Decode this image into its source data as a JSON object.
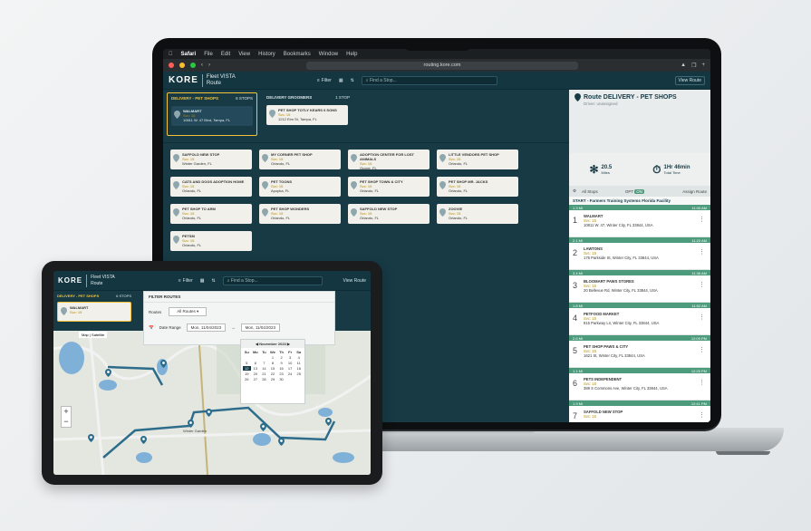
{
  "menubar": {
    "app": "Safari",
    "items": [
      "File",
      "Edit",
      "View",
      "History",
      "Bookmarks",
      "Window",
      "Help"
    ]
  },
  "browser": {
    "url": "routing.kore.com"
  },
  "app": {
    "logo": "KORE",
    "title_line1": "Fleet VISTA",
    "title_line2": "Route",
    "filter_label": "Filter",
    "search_placeholder": "Find a Stop...",
    "view_route_label": "View Route"
  },
  "groups": [
    {
      "label": "DELIVERY - PET SHOPS",
      "count": "6 STOPS",
      "stop": {
        "name": "WALMART",
        "line1": "Svc: 15",
        "line2": "10811 W. 47 Blvd, Tampa, FL"
      }
    },
    {
      "label": "DELIVERY GROOMERS",
      "count": "1 STOP",
      "stop": {
        "name": "PET SHOP TOTLY KEARS 6 SONS",
        "line1": "Svc: 15",
        "line2": "1212 Elm St, Tampa, FL"
      }
    }
  ],
  "unassigned": [
    {
      "name": "SAFFOLD NEW STOP",
      "line1": "Svc: 15",
      "line2": "Winter Garden, FL"
    },
    {
      "name": "MY CORNER PET SHOP",
      "line1": "Svc: 15",
      "line2": "Orlando, FL"
    },
    {
      "name": "ADOPTION CENTER FOR LOST ANIMALS",
      "line1": "Svc: 15",
      "line2": "Ocoee, FL"
    },
    {
      "name": "LITTLE VENDORS PET SHOP",
      "line1": "Svc: 15",
      "line2": "Orlando, FL"
    },
    {
      "name": "CATS AND DOGS ADOPTION HOME",
      "line1": "Svc: 15",
      "line2": "Orlando, FL"
    },
    {
      "name": "PET TOONS",
      "line1": "Svc: 15",
      "line2": "Apopka, FL"
    },
    {
      "name": "PET SHOP TOWN & CITY",
      "line1": "Svc: 15",
      "line2": "Orlando, FL"
    },
    {
      "name": "PET SHOP MR. JACKS",
      "line1": "Svc: 15",
      "line2": "Orlando, FL"
    },
    {
      "name": "PET SHOP TO ARM",
      "line1": "Svc: 15",
      "line2": "Orlando, FL"
    },
    {
      "name": "PET SHOP WONDERS",
      "line1": "Svc: 15",
      "line2": "Orlando, FL"
    },
    {
      "name": "SAFFOLD NEW STOP",
      "line1": "Svc: 15",
      "line2": "Orlando, FL"
    },
    {
      "name": "ZOOVIE",
      "line1": "Svc: 15",
      "line2": "Orlando, FL"
    },
    {
      "name": "PETSM",
      "line1": "Svc: 15",
      "line2": "Orlando, FL"
    }
  ],
  "route_panel": {
    "title": "Route DELIVERY - PET SHOPS",
    "subtitle": "Driver: unassigned",
    "distance": "20.5",
    "distance_unit": "Miles",
    "time": "1Hr 46min",
    "time_unit": "Total Time",
    "all_stops": "All Stops",
    "opt": "OPT",
    "assign_label": "Assign Route",
    "start": "START - Farmers Training Systems Florida Facility",
    "stops": [
      {
        "num": "1",
        "name": "WALMART",
        "svc": "Svc: 15",
        "addr": "10811 W. 47, Winter City, FL 33844, USA",
        "eta": "11:05 AM",
        "dist": "1.3 MI"
      },
      {
        "num": "2",
        "name": "LAWTONS",
        "svc": "Svc: 15",
        "addr": "176 Parkside St, Winter City, FL 33844, USA",
        "eta": "11:20 AM",
        "dist": "2.1 MI"
      },
      {
        "num": "3",
        "name": "BLOOMART PAWS STORES",
        "svc": "Svc: 15",
        "addr": "20 Bellevue Rd, Winter City, FL 33844, USA",
        "eta": "11:36 AM",
        "dist": "3.4 MI"
      },
      {
        "num": "4",
        "name": "PETFOOD MARKET",
        "svc": "Svc: 15",
        "addr": "815 Parkway Ln, Winter City, FL 33844, USA",
        "eta": "11:52 AM",
        "dist": "1.8 MI"
      },
      {
        "num": "5",
        "name": "PET SHOP PAWS & CITY",
        "svc": "Svc: 15",
        "addr": "1621 St, Winter City, FL 33844, USA",
        "eta": "12:09 PM",
        "dist": "2.6 MI"
      },
      {
        "num": "6",
        "name": "PETS INDEPENDENT",
        "svc": "Svc: 15",
        "addr": "389 S Commons Ave, Winter City, FL 33844, USA",
        "eta": "12:25 PM",
        "dist": "1.1 MI"
      },
      {
        "num": "7",
        "name": "SAFFOLD NEW STOP",
        "svc": "Svc: 15",
        "addr": "",
        "eta": "12:41 PM",
        "dist": "1.9 MI"
      }
    ]
  },
  "tablet": {
    "filter_title": "FILTER ROUTES",
    "routes_label": "Routes",
    "routes_value": "All Routes",
    "date_label": "Date Range",
    "date_from": "Mon, 11/04/2023",
    "date_to": "Mon, 11/04/2023",
    "calendar_month": "November 2023",
    "weekdays": [
      "Su",
      "Mo",
      "Tu",
      "We",
      "Th",
      "Fr",
      "Sa"
    ],
    "days": [
      "",
      "",
      "",
      "1",
      "2",
      "3",
      "4",
      "5",
      "6",
      "7",
      "8",
      "9",
      "10",
      "11",
      "12",
      "13",
      "14",
      "15",
      "16",
      "17",
      "18",
      "19",
      "20",
      "21",
      "22",
      "23",
      "24",
      "25",
      "26",
      "27",
      "28",
      "29",
      "30"
    ],
    "selected_day": "12",
    "map_labels": [
      "Winter Garden"
    ],
    "tabs": [
      "Map",
      "Satellite"
    ]
  },
  "colors": {
    "accent": "#173a45",
    "highlight": "#f3c23a",
    "route": "#2d6c8a",
    "stop_bar": "#4c9b7d"
  }
}
